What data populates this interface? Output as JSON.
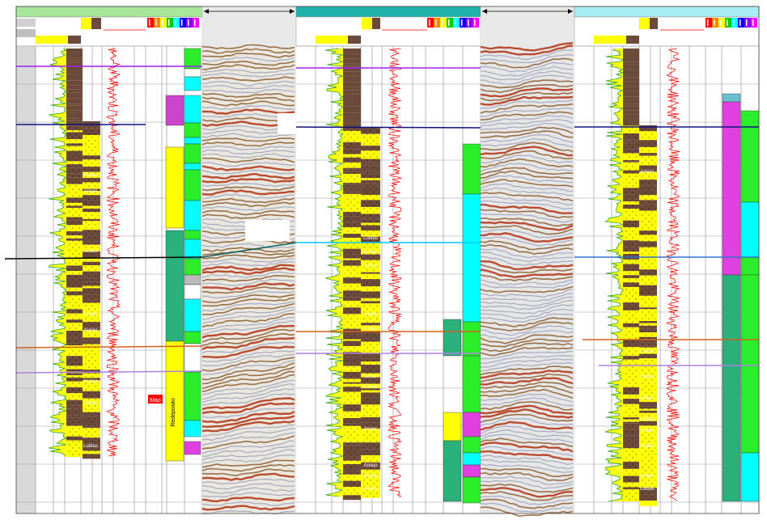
{
  "colors": {
    "well1_header": "#a8e69a",
    "well2_header": "#20b2aa",
    "well3_header": "#a8ecf4",
    "sand": "#ffff00",
    "shale": "#6b4a3a",
    "gr_curve": "#2aa02a",
    "res_curve": "#ff0000",
    "strip_green": "#2aee2a",
    "strip_cyan": "#00ffff",
    "strip_magenta": "#e040e0",
    "strip_teal": "#2ab07a",
    "horizon_purple": "#a020f0",
    "horizon_navy": "#101080",
    "horizon_cyan": "#00c8ff",
    "horizon_orange": "#d06020",
    "horizon_violet": "#b080e0",
    "seismic_brown": "#8b5a2b",
    "seismic_red": "#b03010"
  },
  "wells": [
    {
      "id": "well-1",
      "lithology_labels": [
        "Areias",
        "Areias",
        "Lutitas",
        "Areias",
        "Areias",
        "Areias",
        "Areias",
        "Lutitas"
      ],
      "facies_labels": [
        "Mao",
        "Redeposito"
      ]
    },
    {
      "id": "well-2",
      "lithology_labels": [
        "Lutitas",
        "Areias",
        "Lutitas",
        "Areias",
        "Areias",
        "Lutitas",
        "Areias",
        "Areias",
        "Areias",
        "Areias",
        "Areias"
      ]
    },
    {
      "id": "well-3",
      "lithology_labels": [
        "Areias",
        "Lutitas",
        "Areias",
        "Areias",
        "Lutitas",
        "Areias",
        "Areias",
        "Areias",
        "Lutitas"
      ]
    }
  ],
  "seismic_panels": [
    {
      "id": "seismic-1",
      "arrow": "double-arrow"
    },
    {
      "id": "seismic-2",
      "arrow": "double-arrow"
    }
  ]
}
